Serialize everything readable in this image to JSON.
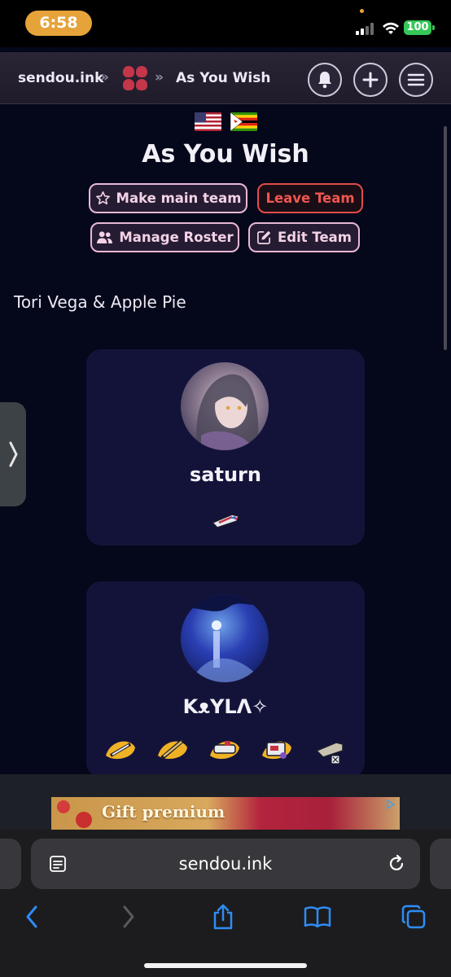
{
  "status_bar": {
    "time": "6:58",
    "battery": "100"
  },
  "nav": {
    "site": "sendou.ink",
    "separator": "»",
    "current": "As You Wish",
    "icons": [
      "bell-icon",
      "plus-icon",
      "menu-icon"
    ]
  },
  "team": {
    "flags": [
      "us-flag",
      "zw-flag"
    ],
    "name": "As You Wish",
    "buttons": {
      "make_main": "Make main team",
      "leave": "Leave Team",
      "manage_roster": "Manage Roster",
      "edit": "Edit Team"
    },
    "description": "Tori Vega & Apple Pie"
  },
  "members": [
    {
      "name": "saturn",
      "weapons": [
        "weapon-icon"
      ]
    },
    {
      "name": "KᴥYLΛ✧",
      "weapons": [
        "weapon-icon",
        "weapon-icon",
        "weapon-icon",
        "weapon-icon",
        "weapon-icon"
      ]
    }
  ],
  "ad": {
    "text": "Gift premium"
  },
  "browser": {
    "url": "sendou.ink"
  },
  "colors": {
    "accent_pink": "#e9b8d5",
    "danger": "#e04d4a",
    "card_bg": "#13133a",
    "page_bg": "#05071a"
  }
}
